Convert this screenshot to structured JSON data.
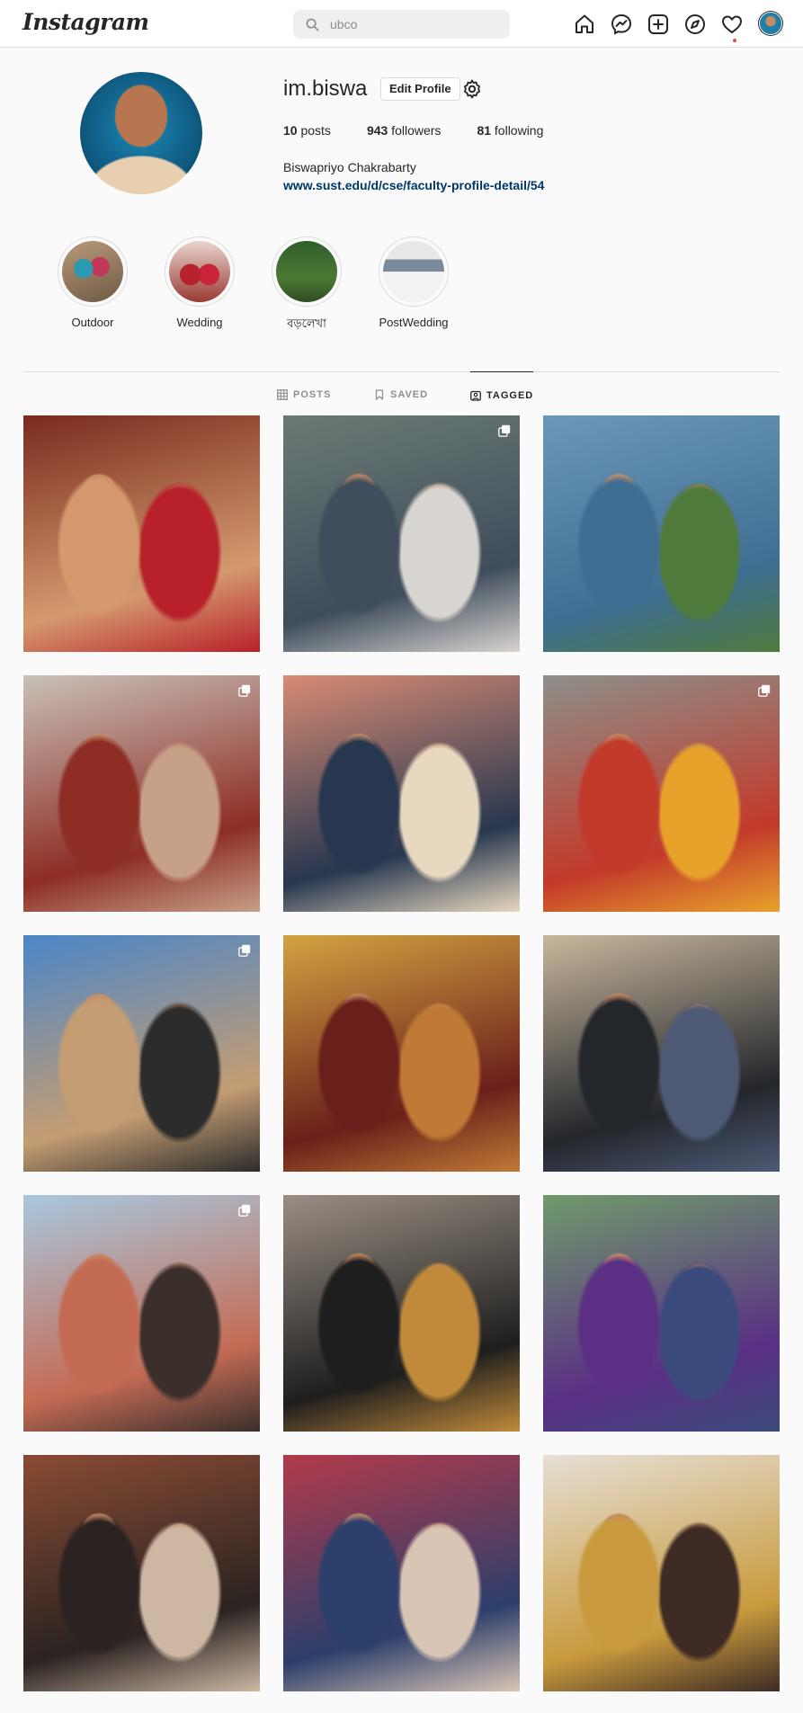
{
  "nav": {
    "logo": "Instagram",
    "search_value": "ubco",
    "icons": [
      "home-icon",
      "messenger-icon",
      "new-post-icon",
      "explore-icon",
      "activity-heart-icon",
      "profile-avatar"
    ]
  },
  "profile": {
    "username": "im.biswa",
    "edit_label": "Edit Profile",
    "posts_count": "10",
    "posts_label": "posts",
    "followers_count": "943",
    "followers_label": "followers",
    "following_count": "81",
    "following_label": "following",
    "full_name": "Biswapriyo Chakrabarty",
    "website": "www.sust.edu/d/cse/faculty-profile-detail/54"
  },
  "highlights": [
    {
      "label": "Outdoor"
    },
    {
      "label": "Wedding"
    },
    {
      "label": "বড়লেখা"
    },
    {
      "label": "PostWedding"
    }
  ],
  "tabs": [
    {
      "label": "POSTS",
      "icon": "grid-icon",
      "active": false
    },
    {
      "label": "SAVED",
      "icon": "bookmark-icon",
      "active": false
    },
    {
      "label": "TAGGED",
      "icon": "tagged-icon",
      "active": true
    }
  ],
  "grid": {
    "photos": [
      {
        "name": "wedding-couple-portrait",
        "multi": false,
        "colors": [
          "#7a2a1e",
          "#d49a6e",
          "#b8202a"
        ]
      },
      {
        "name": "couple-at-waterfall",
        "multi": true,
        "colors": [
          "#6b7a74",
          "#3f4d5c",
          "#d8d4cf"
        ]
      },
      {
        "name": "couple-in-flower-field",
        "multi": false,
        "colors": [
          "#6c98b8",
          "#3e6e92",
          "#4f7a3c"
        ]
      },
      {
        "name": "wedding-stage-couple",
        "multi": true,
        "colors": [
          "#c9c1b8",
          "#8d2d24",
          "#c6a087"
        ]
      },
      {
        "name": "three-friends-doorway",
        "multi": false,
        "colors": [
          "#d88b74",
          "#27374f",
          "#e7d8bf"
        ]
      },
      {
        "name": "couple-on-swing",
        "multi": true,
        "colors": [
          "#8d8f8a",
          "#c23a2a",
          "#e8a22c"
        ]
      },
      {
        "name": "group-at-church",
        "multi": true,
        "colors": [
          "#4b86c8",
          "#c49d72",
          "#2c2c2c"
        ]
      },
      {
        "name": "friends-at-restaurant",
        "multi": false,
        "colors": [
          "#d2a341",
          "#6b1f1a",
          "#c07a36"
        ]
      },
      {
        "name": "selfie-in-car",
        "multi": false,
        "colors": [
          "#c8b79c",
          "#23262b",
          "#4e5a75"
        ]
      },
      {
        "name": "friends-on-beach",
        "multi": true,
        "colors": [
          "#a8c8de",
          "#c46b54",
          "#3a2f2b"
        ]
      },
      {
        "name": "two-friends-sunglasses",
        "multi": false,
        "colors": [
          "#9a8e83",
          "#1e1e1e",
          "#c08a3a"
        ]
      },
      {
        "name": "two-friends-purple-shirts",
        "multi": false,
        "colors": [
          "#6f9a6b",
          "#5a2f84",
          "#3b4a7c"
        ]
      },
      {
        "name": "group-selfie-indoors",
        "multi": false,
        "colors": [
          "#8a4b34",
          "#2a2321",
          "#cdb7a3"
        ]
      },
      {
        "name": "family-at-ceremony",
        "multi": false,
        "colors": [
          "#b23a4a",
          "#2d3f6b",
          "#d9c5b4"
        ]
      },
      {
        "name": "friends-at-cafe",
        "multi": false,
        "colors": [
          "#e6dfd5",
          "#c89a3d",
          "#3d2b24"
        ]
      }
    ]
  }
}
